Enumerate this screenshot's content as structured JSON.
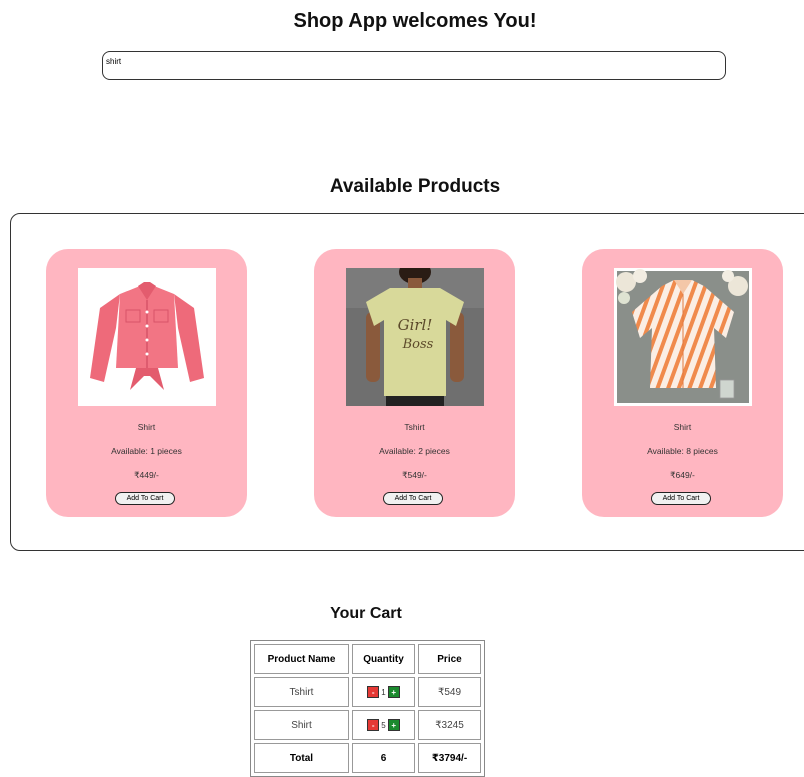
{
  "header": {
    "title": "Shop App welcomes You!"
  },
  "search": {
    "value": "shirt",
    "placeholder": ""
  },
  "products_section": {
    "title": "Available Products"
  },
  "products": [
    {
      "name": "Shirt",
      "availability": "Available: 1 pieces",
      "price": "₹449/-",
      "button": "Add To Cart"
    },
    {
      "name": "Tshirt",
      "availability": "Available: 2 pieces",
      "price": "₹549/-",
      "button": "Add To Cart"
    },
    {
      "name": "Shirt",
      "availability": "Available: 8 pieces",
      "price": "₹649/-",
      "button": "Add To Cart"
    }
  ],
  "cart": {
    "title": "Your Cart",
    "headers": [
      "Product Name",
      "Quantity",
      "Price"
    ],
    "rows": [
      {
        "name": "Tshirt",
        "quantity": "1",
        "price": "₹549"
      },
      {
        "name": "Shirt",
        "quantity": "5",
        "price": "₹3245"
      }
    ],
    "total": {
      "label": "Total",
      "quantity": "6",
      "price": "₹3794/-"
    },
    "minus_label": "-",
    "plus_label": "+"
  },
  "colors": {
    "card_background": "#ffb6c1",
    "minus_button": "#e53935",
    "plus_button": "#1b8a2e"
  }
}
